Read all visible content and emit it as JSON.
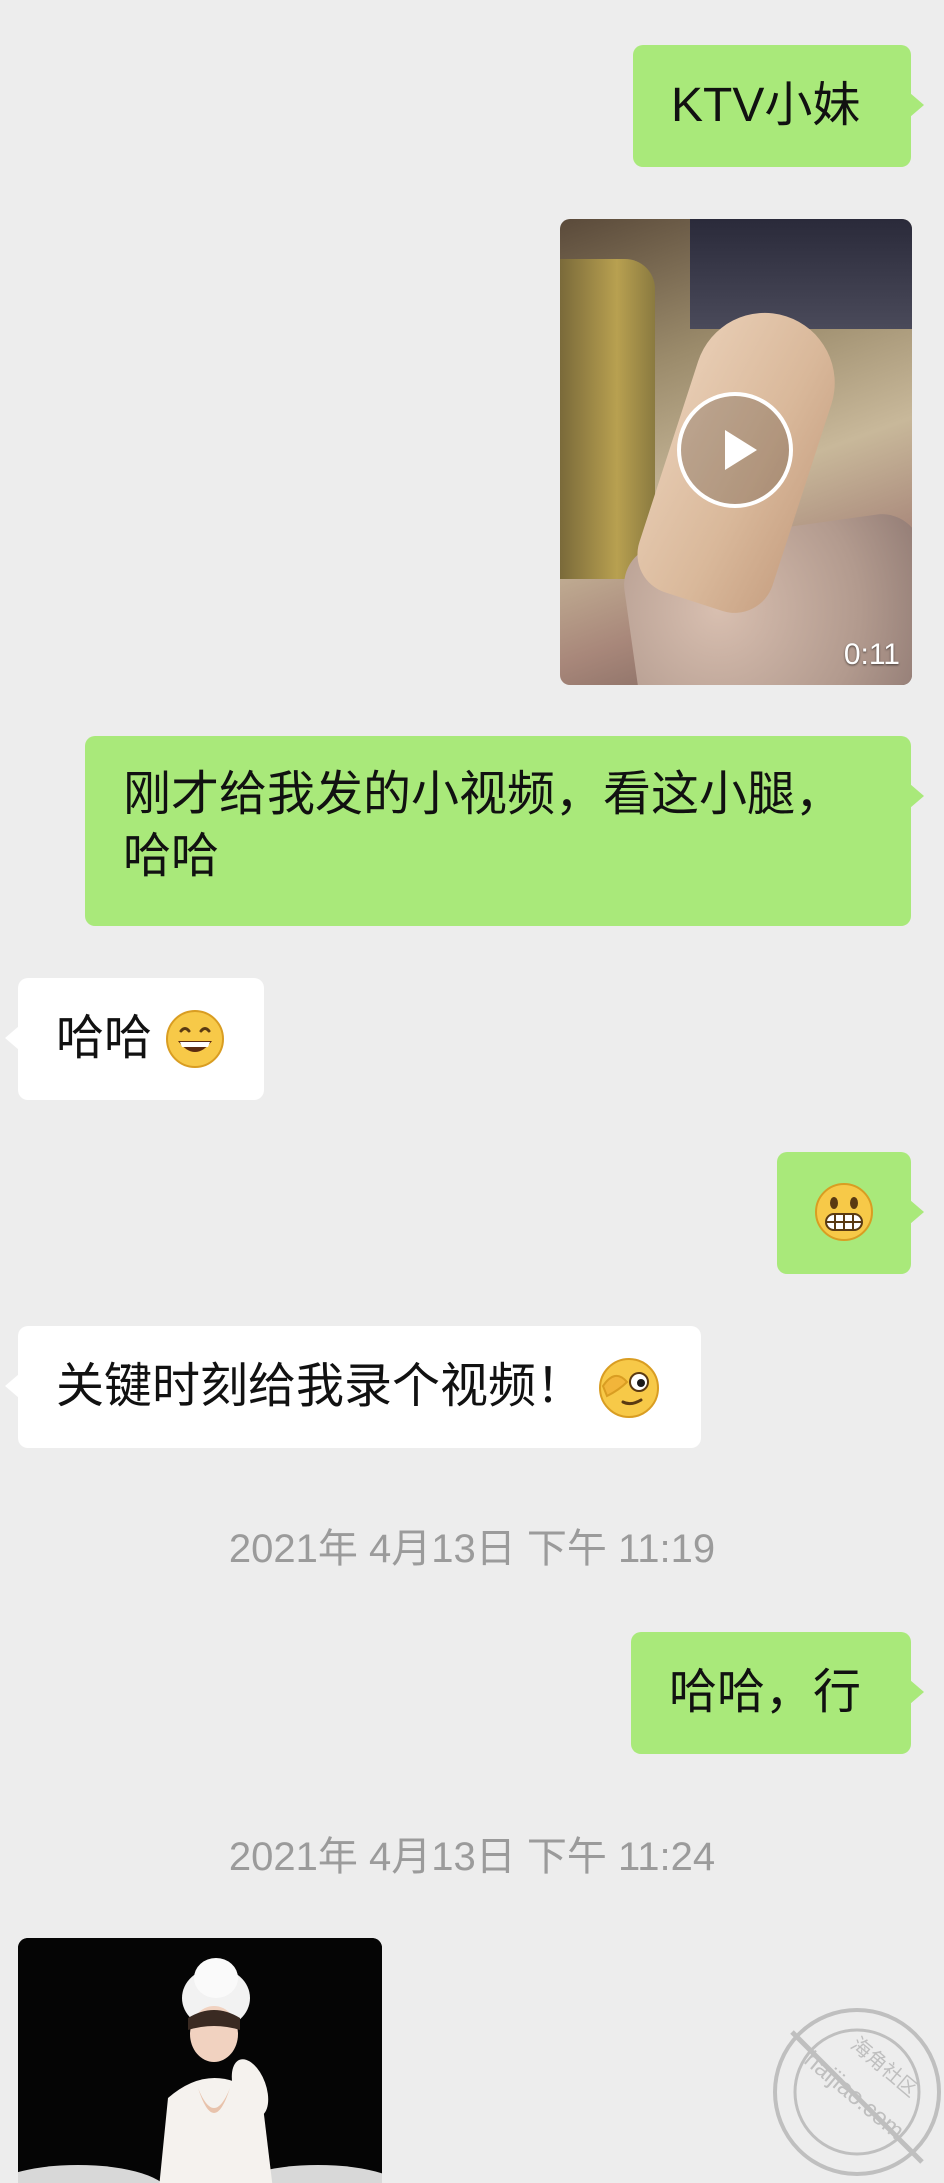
{
  "messages": {
    "m1": {
      "text": "KTV小妹"
    },
    "video": {
      "duration": "0:11"
    },
    "m3": {
      "text": "刚才给我发的小视频，看这小腿，哈哈"
    },
    "m4": {
      "text": "哈哈"
    },
    "m6": {
      "text": "关键时刻给我录个视频！"
    },
    "m7": {
      "text": "哈哈，行"
    }
  },
  "timestamps": {
    "t1": "2021年 4月13日 下午 11:19",
    "t2": "2021年 4月13日 下午 11:24"
  },
  "watermark": {
    "text": "haijiao.com 海角社区"
  },
  "colors": {
    "background": "#ededed",
    "sent_bubble": "#a9e97a",
    "received_bubble": "#ffffff",
    "timestamp_text": "#9b9b9b"
  },
  "icons": {
    "play": "play-icon",
    "grin": "grinning-face-emoji",
    "grimace": "grimacing-face-emoji",
    "wink": "peeking-face-emoji"
  }
}
